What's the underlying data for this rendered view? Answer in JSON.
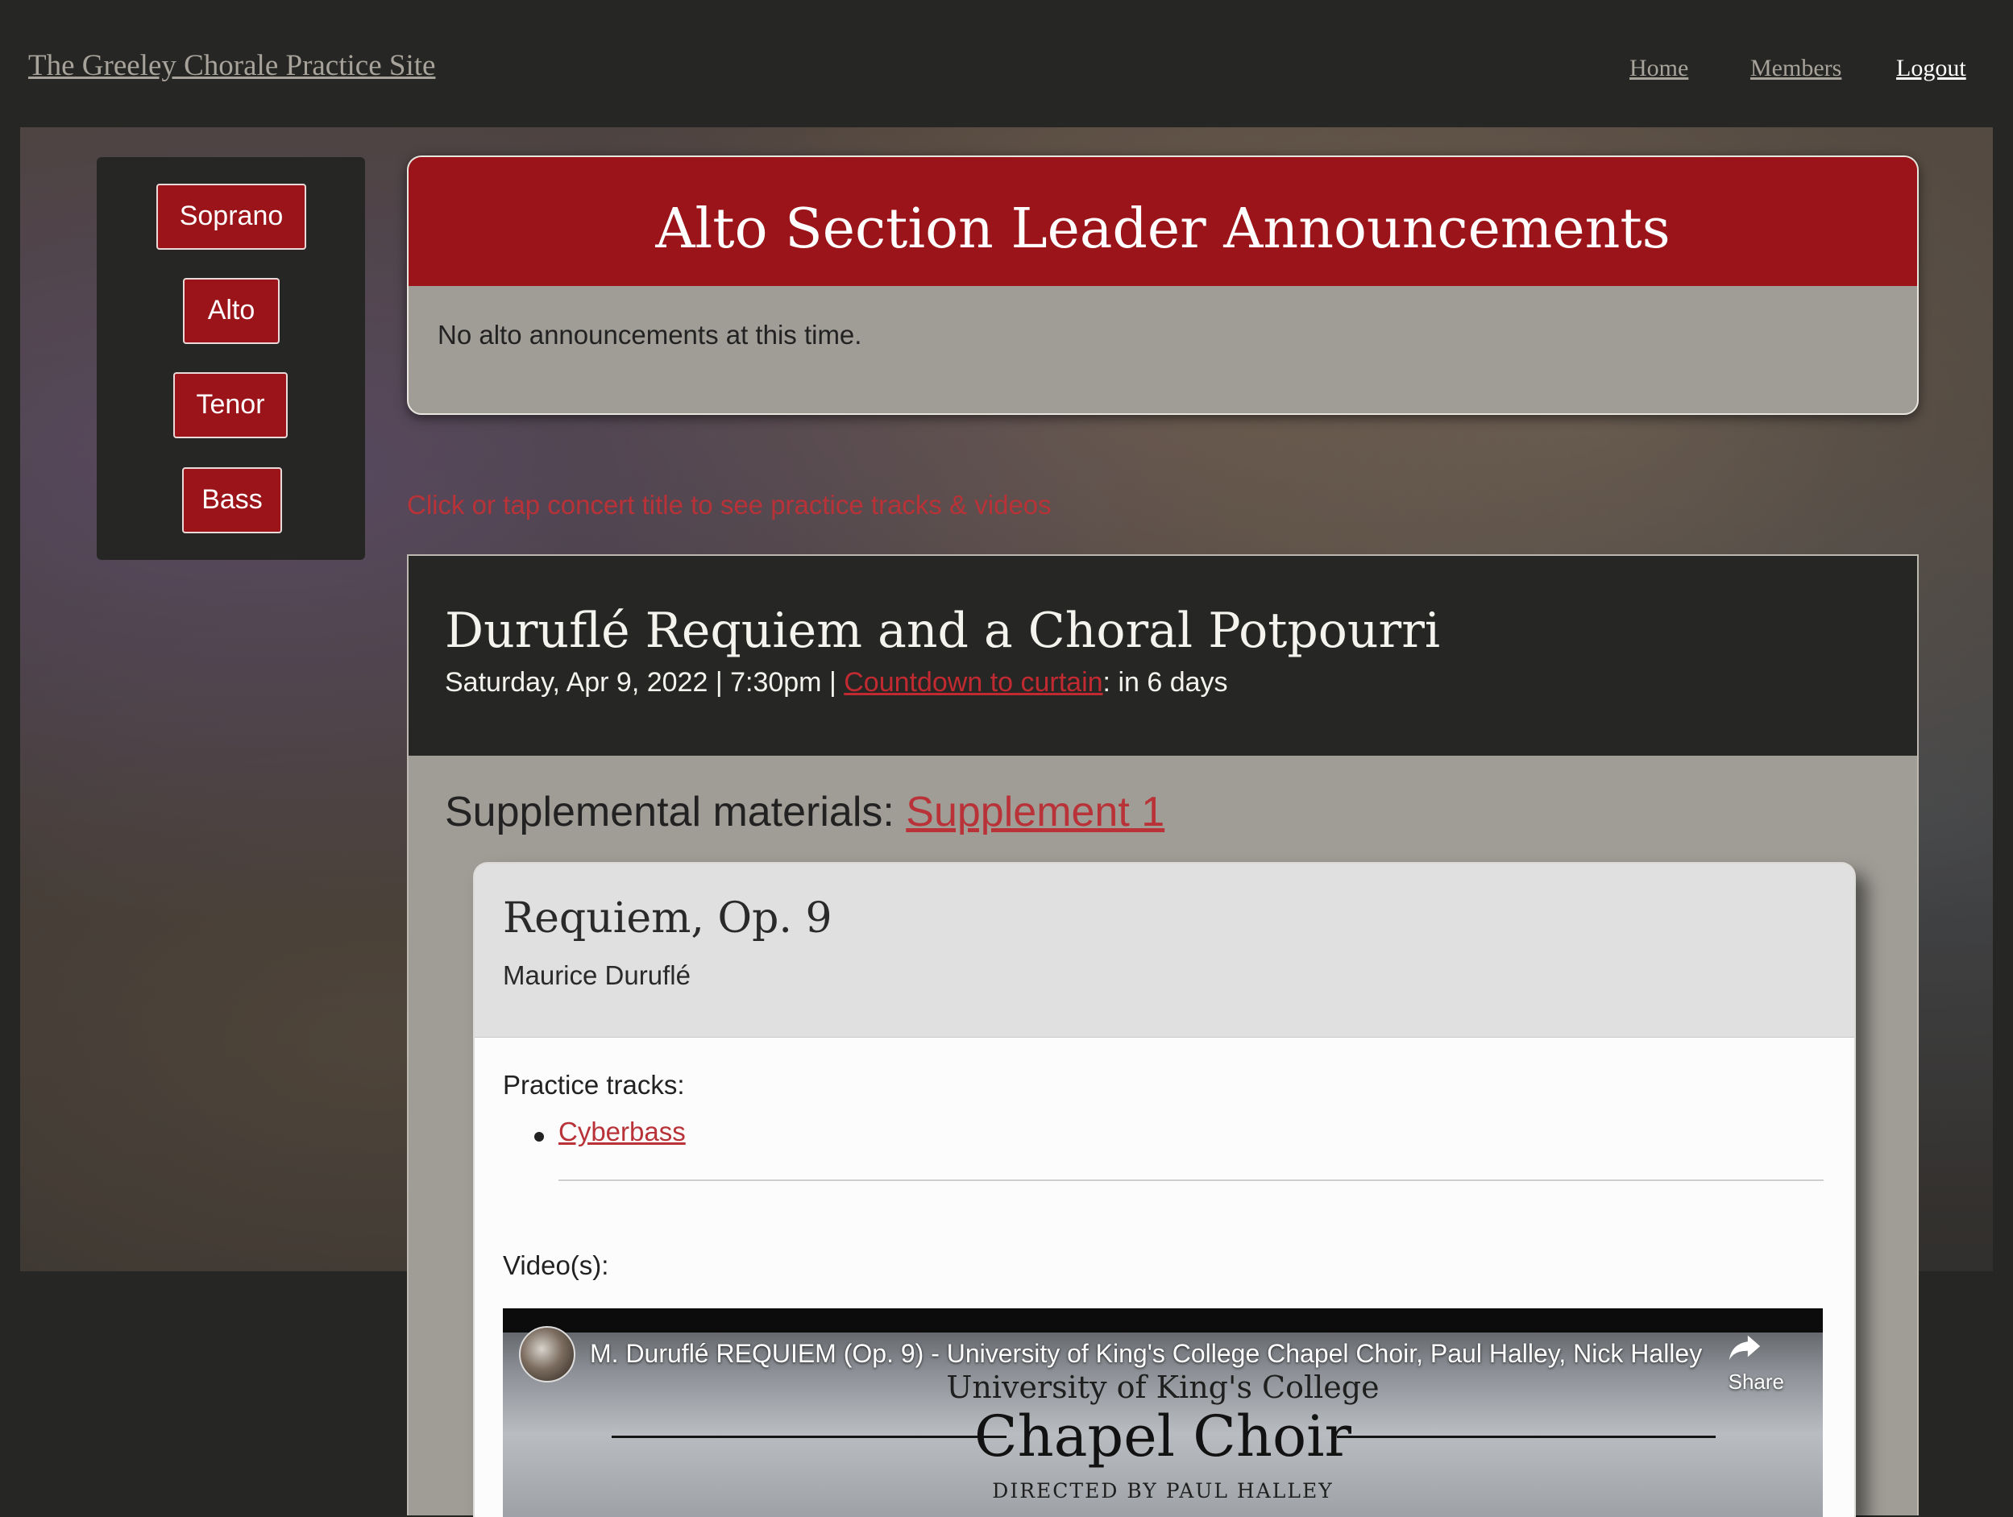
{
  "site": {
    "title": "The Greeley Chorale Practice Site"
  },
  "nav": {
    "home": "Home",
    "members": "Members",
    "logout": "Logout"
  },
  "sidebar": {
    "buttons": [
      "Soprano",
      "Alto",
      "Tenor",
      "Bass"
    ]
  },
  "announcements": {
    "title": "Alto Section Leader Announcements",
    "body": "No alto announcements at this time."
  },
  "hint": "Click or tap concert title to see practice tracks & videos",
  "concert": {
    "title": "Duruflé Requiem and a Choral Potpourri",
    "date_time": "Saturday, Apr 9, 2022 | 7:30pm | ",
    "countdown_label": "Countdown to curtain",
    "countdown_value": ": in 6 days",
    "supplemental_label": "Supplemental materials: ",
    "supplemental_link": "Supplement 1"
  },
  "piece": {
    "title": "Requiem, Op. 9",
    "composer": "Maurice Duruflé",
    "practice_label": "Practice tracks:",
    "tracks": [
      "Cyberbass"
    ],
    "video_label": "Video(s):"
  },
  "video": {
    "title": "M. Duruflé REQUIEM (Op. 9) - University of King's College Chapel Choir, Paul Halley, Nick Halley",
    "share_label": "Share",
    "line1": "University of King's College",
    "line2": "Chapel Choir",
    "line3": "DIRECTED BY PAUL HALLEY"
  },
  "colors": {
    "accent": "#9b1419",
    "link": "#b83238",
    "background": "#262724"
  }
}
